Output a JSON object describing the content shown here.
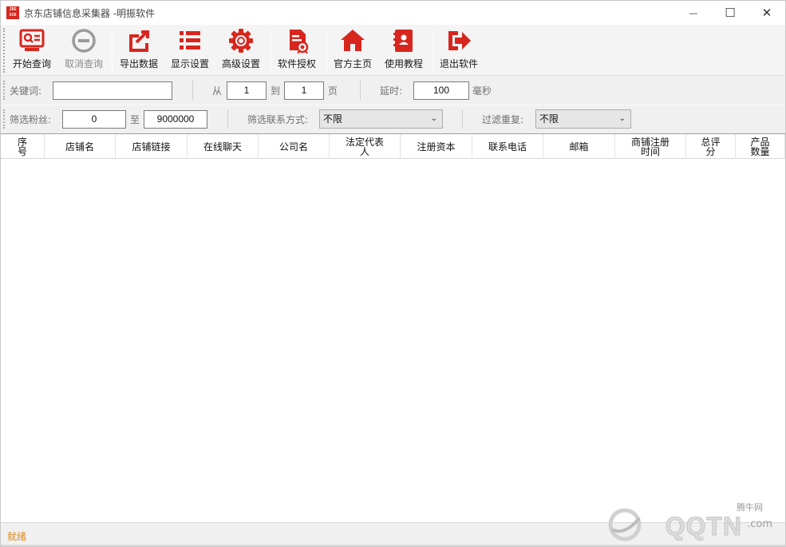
{
  "window": {
    "title": "京东店铺信息采集器 -明振软件",
    "icon_text": [
      "JDG",
      "SCK"
    ],
    "controls": {
      "minimize": "—",
      "maximize": "☐",
      "close": "✕"
    }
  },
  "toolbar": {
    "buttons": [
      {
        "label": "开始查询",
        "icon": "search-card-icon",
        "enabled": true
      },
      {
        "label": "取消查询",
        "icon": "cancel-circle-icon",
        "enabled": false
      },
      {
        "label": "导出数据",
        "icon": "export-icon",
        "enabled": true
      },
      {
        "label": "显示设置",
        "icon": "list-icon",
        "enabled": true
      },
      {
        "label": "高级设置",
        "icon": "gear-icon",
        "enabled": true
      },
      {
        "label": "软件授权",
        "icon": "license-icon",
        "enabled": true
      },
      {
        "label": "官方主页",
        "icon": "home-icon",
        "enabled": true
      },
      {
        "label": "使用教程",
        "icon": "book-icon",
        "enabled": true
      },
      {
        "label": "退出软件",
        "icon": "exit-icon",
        "enabled": true
      }
    ]
  },
  "search_row": {
    "keyword_label": "关键词:",
    "keyword_value": "",
    "from_label": "从",
    "page_from": "1",
    "to_label": "到",
    "page_to": "1",
    "page_unit": "页",
    "delay_label": "延时:",
    "delay_value": "100",
    "delay_unit": "毫秒"
  },
  "filter_row": {
    "fans_label": "筛选粉丝:",
    "fans_min": "0",
    "fans_to_label": "至",
    "fans_max": "9000000",
    "contact_label": "筛选联系方式:",
    "contact_value": "不限",
    "dedupe_label": "过滤重复:",
    "dedupe_value": "不限"
  },
  "grid": {
    "columns": [
      [
        "序",
        "号"
      ],
      [
        "店铺名"
      ],
      [
        "店铺链接"
      ],
      [
        "在线聊天"
      ],
      [
        "公司名"
      ],
      [
        "法定代表",
        "人"
      ],
      [
        "注册资本"
      ],
      [
        "联系电话"
      ],
      [
        "邮箱"
      ],
      [
        "商铺注册",
        "时间"
      ],
      [
        "总评",
        "分"
      ],
      [
        "产品",
        "数量"
      ]
    ],
    "rows": []
  },
  "status": {
    "text": "就绪"
  },
  "watermark": {
    "small": "腾牛网",
    "big": "QQTN",
    "suffix": ".com"
  },
  "colors": {
    "icon_red": "#d7261e",
    "disabled_gray": "#9a9a9a",
    "status_orange": "#d98a1a"
  }
}
